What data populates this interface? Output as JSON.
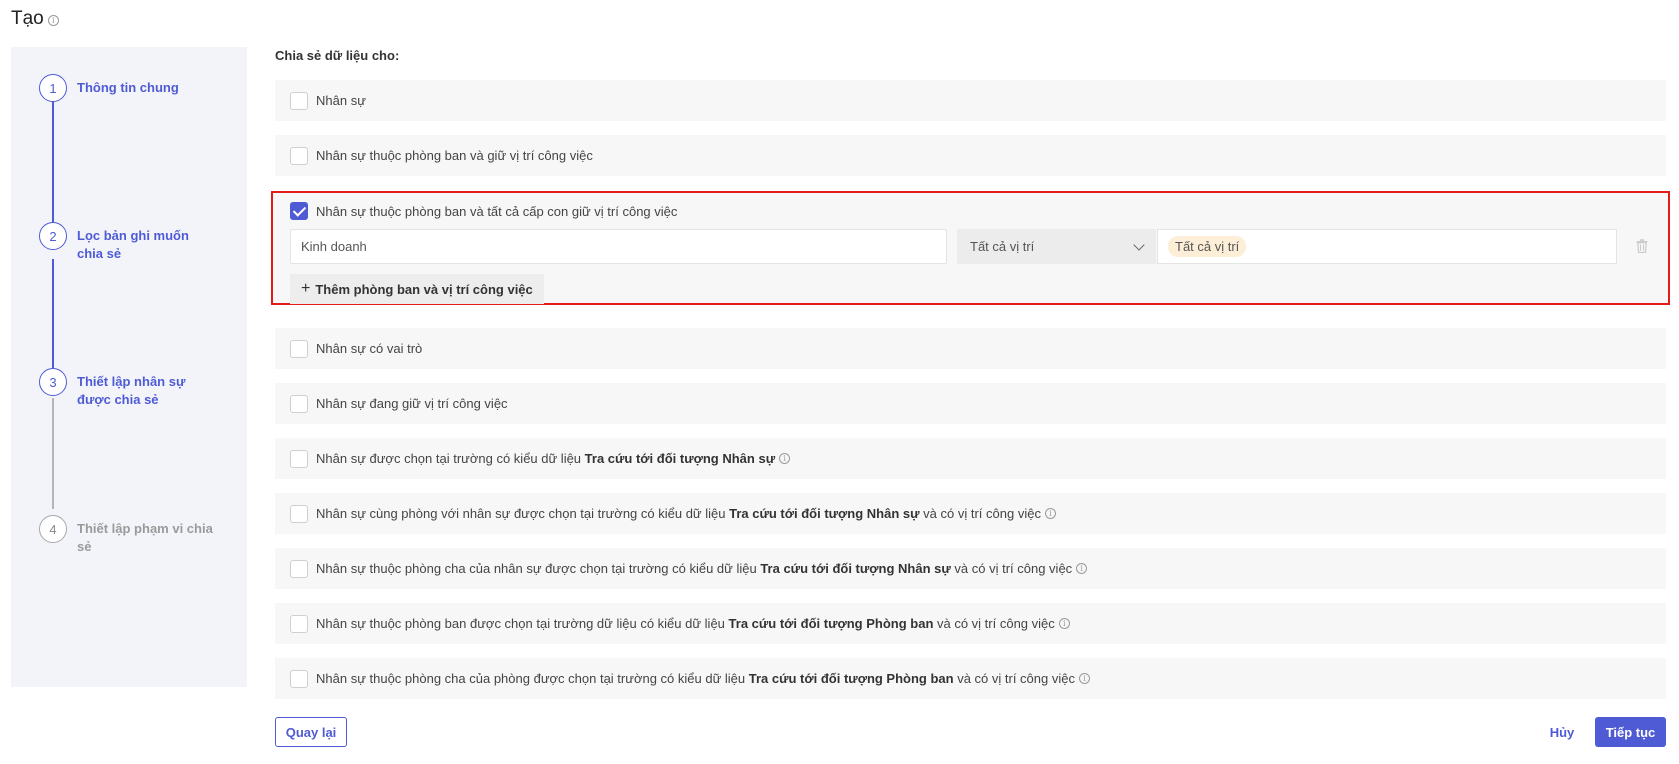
{
  "page": {
    "title": "Tạo"
  },
  "stepper": {
    "steps": [
      {
        "number": "1",
        "label": "Thông tin chung",
        "state": "done"
      },
      {
        "number": "2",
        "label": "Lọc bản ghi muốn chia sẻ",
        "state": "done"
      },
      {
        "number": "3",
        "label": "Thiết lập nhân sự được chia sẻ",
        "state": "active"
      },
      {
        "number": "4",
        "label": "Thiết lập phạm vi chia sẻ",
        "state": "inactive"
      }
    ],
    "active_color": "#4f5bd5",
    "inactive_color": "#a8a8a8"
  },
  "main": {
    "section_label": "Chia sẻ dữ liệu cho:",
    "options": [
      {
        "pre": "Nhân sự",
        "bold": "",
        "post": "",
        "info": false,
        "checked": false
      },
      {
        "pre": "Nhân sự thuộc phòng ban và giữ vị trí công việc",
        "bold": "",
        "post": "",
        "info": false,
        "checked": false
      },
      {
        "pre": "Nhân sự thuộc phòng ban và tất cả cấp con giữ vị trí công việc",
        "bold": "",
        "post": "",
        "info": false,
        "checked": true
      },
      {
        "pre": "Nhân sự có vai trò",
        "bold": "",
        "post": "",
        "info": false,
        "checked": false
      },
      {
        "pre": "Nhân sự đang giữ vị trí công việc",
        "bold": "",
        "post": "",
        "info": false,
        "checked": false
      },
      {
        "pre": "Nhân sự được chọn tại trường có kiểu dữ liệu ",
        "bold": "Tra cứu tới đối tượng Nhân sự",
        "post": "",
        "info": true,
        "checked": false
      },
      {
        "pre": "Nhân sự cùng phòng với nhân sự được chọn tại trường có kiểu dữ liệu ",
        "bold": "Tra cứu tới đối tượng Nhân sự",
        "post": " và có vị trí công việc",
        "info": true,
        "checked": false
      },
      {
        "pre": "Nhân sự thuộc phòng cha của nhân sự được chọn tại trường có kiểu dữ liệu ",
        "bold": "Tra cứu tới đối tượng Nhân sự",
        "post": " và có vị trí công việc",
        "info": true,
        "checked": false
      },
      {
        "pre": "Nhân sự thuộc phòng ban được chọn tại trường dữ liệu có kiểu dữ liệu ",
        "bold": "Tra cứu tới đối tượng Phòng ban",
        "post": " và có vị trí công việc",
        "info": true,
        "checked": false
      },
      {
        "pre": "Nhân sự thuộc phòng cha của phòng được chọn tại trường có kiểu dữ liệu ",
        "bold": "Tra cứu tới đối tượng Phòng ban",
        "post": " và có vị trí công việc",
        "info": true,
        "checked": false
      }
    ],
    "expanded": {
      "department_value": "Kinh doanh",
      "position_select": "Tất cả vị trí",
      "position_tag": "Tất cả vị trí",
      "add_button": "Thêm phòng ban và vị trí công việc"
    }
  },
  "footer": {
    "back_label": "Quay lại",
    "cancel_label": "Hủy",
    "next_label": "Tiếp tục"
  },
  "colors": {
    "primary": "#4f5bd5",
    "highlight_border": "#e31b1b",
    "tag_bg": "#fdeed8"
  }
}
